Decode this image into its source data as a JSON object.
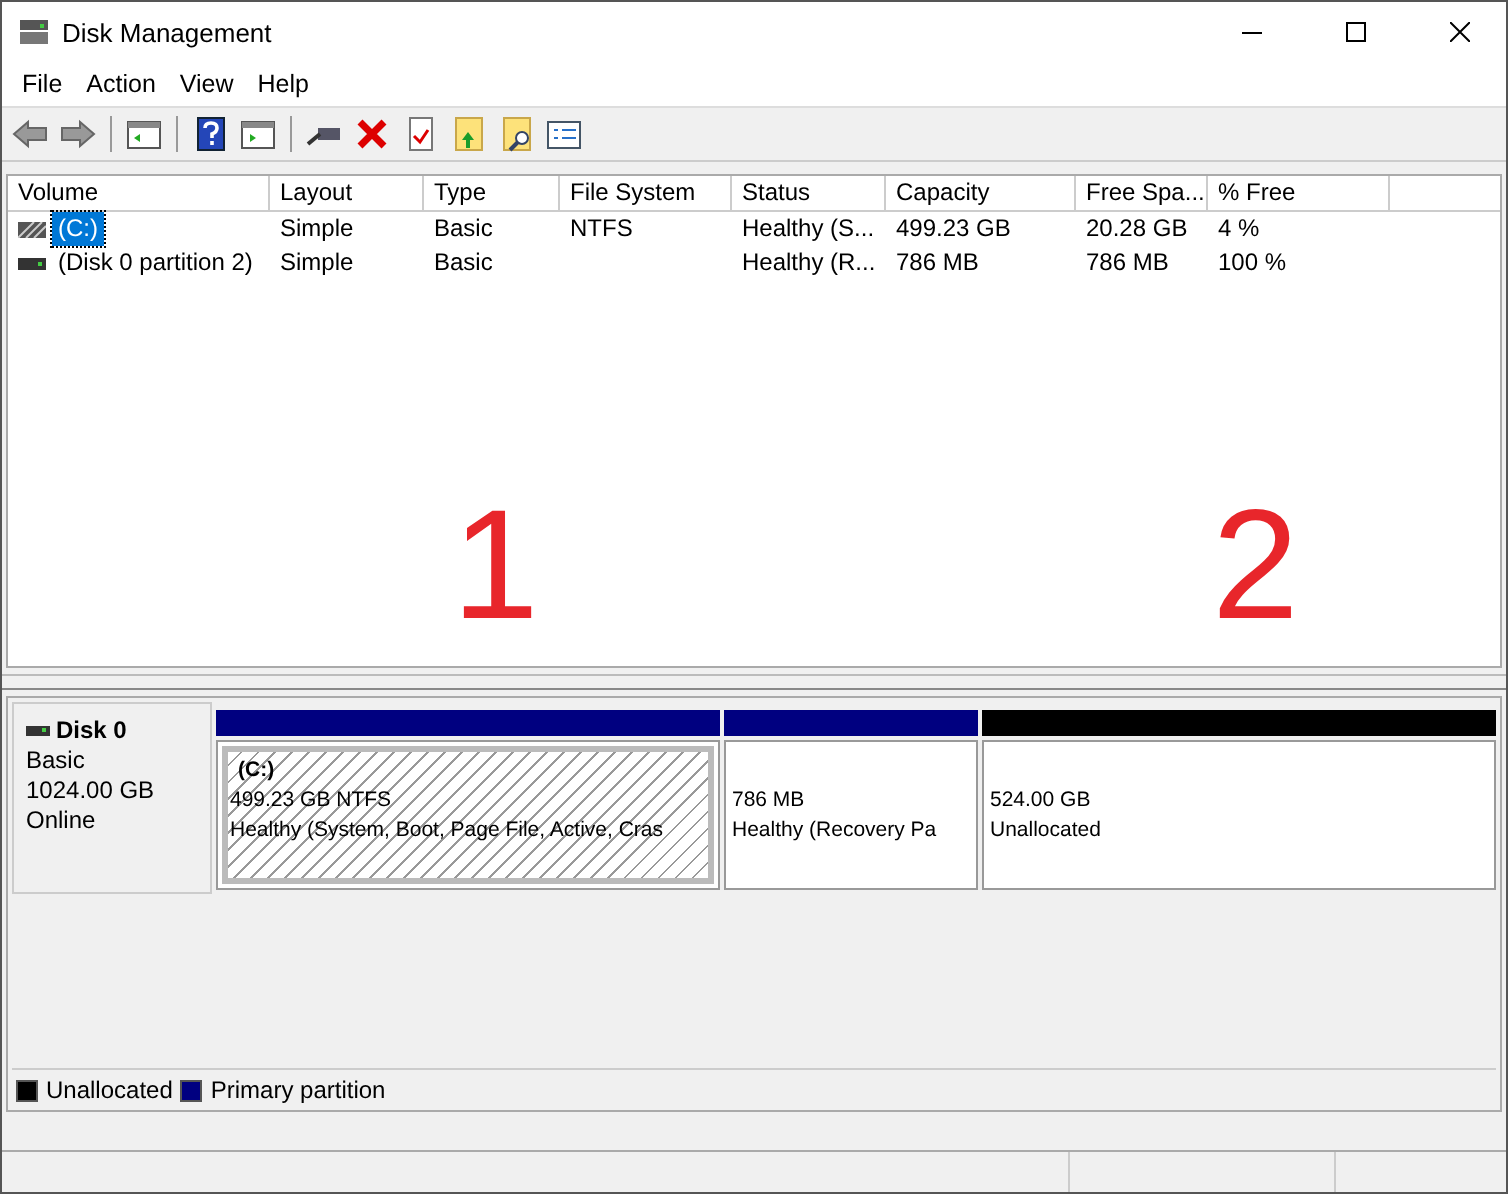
{
  "window": {
    "title": "Disk Management"
  },
  "menu": [
    "File",
    "Action",
    "View",
    "Help"
  ],
  "table": {
    "columns": [
      "Volume",
      "Layout",
      "Type",
      "File System",
      "Status",
      "Capacity",
      "Free Spa...",
      "% Free"
    ],
    "rows": [
      {
        "cells": [
          "(C:)",
          "Simple",
          "Basic",
          "NTFS",
          "Healthy (S...",
          "499.23 GB",
          "20.28 GB",
          "4 %"
        ],
        "selected": true,
        "kind": "hatched"
      },
      {
        "cells": [
          "(Disk 0 partition 2)",
          "Simple",
          "Basic",
          "",
          "Healthy (R...",
          "786 MB",
          "786 MB",
          "100 %"
        ],
        "selected": false,
        "kind": "plain"
      }
    ]
  },
  "annotations": [
    {
      "label": "1"
    },
    {
      "label": "2"
    }
  ],
  "disk": {
    "name": "Disk 0",
    "type": "Basic",
    "size": "1024.00 GB",
    "state": "Online",
    "partitions": [
      {
        "title": "(C:)",
        "size": "499.23 GB NTFS",
        "status": "Healthy (System, Boot, Page File, Active, Cras",
        "color": "#000080",
        "selected": true
      },
      {
        "size": "786 MB",
        "status": "Healthy (Recovery Pa",
        "color": "#000080",
        "selected": false
      },
      {
        "size": "524.00 GB",
        "status": "Unallocated",
        "color": "#000000",
        "selected": false
      }
    ]
  },
  "legend": [
    {
      "label": "Unallocated",
      "color": "#000000"
    },
    {
      "label": "Primary partition",
      "color": "#000080"
    }
  ]
}
